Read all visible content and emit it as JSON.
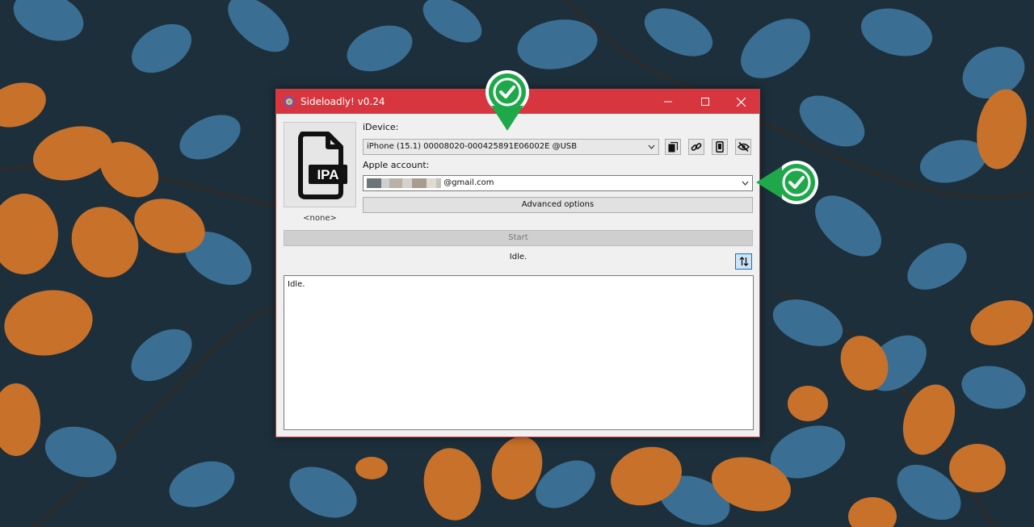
{
  "window": {
    "title": "Sideloadly! v0.24",
    "accent_color": "#d8363f"
  },
  "ipa": {
    "icon_text": "IPA",
    "caption": "<none>"
  },
  "device": {
    "label": "iDevice:",
    "selected": "iPhone (15.1) 00008020-000425891E06002E @USB"
  },
  "toolbar_icons": [
    "copy-icon",
    "link-icon",
    "phone-icon",
    "eye-off-icon"
  ],
  "account": {
    "label": "Apple account:",
    "email_suffix": "@gmail.com",
    "redacted_colors": [
      "#6b7676",
      "#cfcfcf",
      "#b9b0a6",
      "#d5d2cd",
      "#a89c91",
      "#dedad4",
      "#c7c2bb"
    ]
  },
  "buttons": {
    "advanced": "Advanced options",
    "start": "Start"
  },
  "status": {
    "text": "Idle."
  },
  "log": {
    "text": "Idle."
  },
  "annotation": {
    "badge_color": "#1ea84a"
  }
}
